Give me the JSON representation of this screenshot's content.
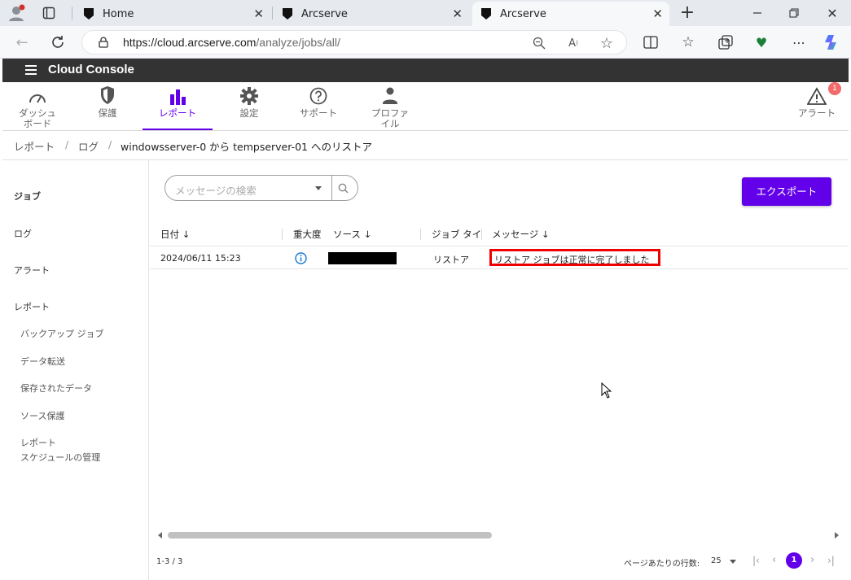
{
  "browser": {
    "tabs": [
      {
        "title": "Home",
        "active": false
      },
      {
        "title": "Arcserve",
        "active": false
      },
      {
        "title": "Arcserve",
        "active": true
      }
    ],
    "url_host": "https://cloud.arcserve.com",
    "url_path": "/analyze/jobs/all/"
  },
  "app": {
    "title": "Cloud Console"
  },
  "nav": {
    "items": [
      {
        "label": "ダッシュ\nボード",
        "icon": "dashboard-icon"
      },
      {
        "label": "保護",
        "icon": "shield-icon"
      },
      {
        "label": "レポート",
        "icon": "bar-chart-icon"
      },
      {
        "label": "設定",
        "icon": "gear-icon"
      },
      {
        "label": "サポート",
        "icon": "help-icon"
      },
      {
        "label": "プロファ\nイル",
        "icon": "person-icon"
      }
    ],
    "active": "レポート",
    "alert_label": "アラート",
    "alert_count": "1"
  },
  "breadcrumb": {
    "items": [
      "レポート",
      "ログ",
      "windowsserver-0 から tempserver-01 へのリストア"
    ],
    "separator": "/"
  },
  "sidebar": {
    "sections": [
      "ジョブ",
      "ログ",
      "アラート",
      "レポート"
    ],
    "report_items": [
      "バックアップ ジョブ",
      "データ転送",
      "保存されたデータ",
      "ソース保護",
      "レポート\nスケジュールの管理"
    ]
  },
  "toolbar": {
    "search_placeholder": "メッセージの検索",
    "export_label": "エクスポート"
  },
  "table": {
    "columns": [
      "日付 ↓",
      "重大度",
      "ソース ↓",
      "ジョブ タイ",
      "メッセージ ↓"
    ],
    "rows": [
      {
        "date": "2024/06/11 15:23",
        "severity": "info",
        "source": "",
        "job_type": "リストア",
        "message": "リストア ジョブは正常に完了しました"
      }
    ]
  },
  "footer": {
    "range": "1-3 / 3",
    "rows_per_page_label": "ページあたりの行数:",
    "rows_per_page": "25",
    "current_page": "1"
  },
  "colors": {
    "accent": "#6200ea",
    "header_bg": "#333333",
    "highlight": "#ee0000"
  }
}
